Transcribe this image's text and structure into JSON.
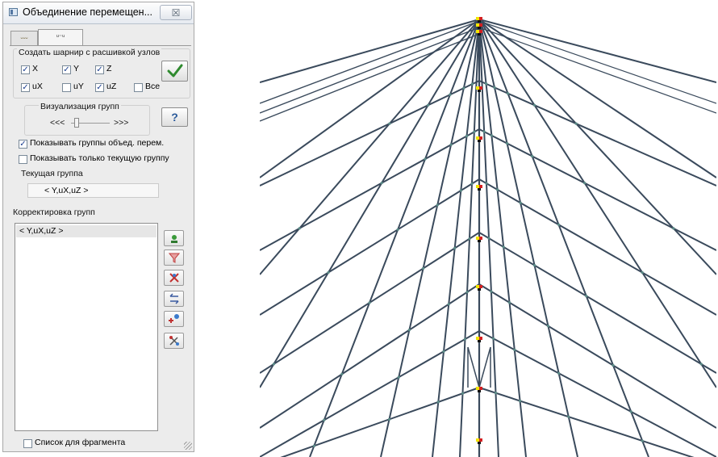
{
  "window": {
    "title": "Объединение перемещен...",
    "close_label": "☒"
  },
  "tabs": [
    {
      "label": "ᵕᵕᵕ",
      "icon": "rigid-link-icon"
    },
    {
      "label": "ᵘ⁻ᵘ",
      "icon": "joint-merge-icon"
    }
  ],
  "hinge": {
    "heading": "Создать шарнир с расшивкой узлов",
    "checks": [
      {
        "label": "X",
        "checked": true
      },
      {
        "label": "Y",
        "checked": true
      },
      {
        "label": "Z",
        "checked": true
      },
      {
        "label": "uX",
        "checked": true
      },
      {
        "label": "uY",
        "checked": false
      },
      {
        "label": "uZ",
        "checked": true
      },
      {
        "label": "Все",
        "checked": false
      }
    ],
    "apply_icon": "checkmark-icon"
  },
  "visualization": {
    "heading": "Визуализация групп",
    "prev_label": "<<<",
    "next_label": ">>>",
    "slider_value": 0,
    "help_label": "?"
  },
  "options": {
    "show_groups": {
      "label": "Показывать группы объед. перем.",
      "checked": true
    },
    "show_current_only": {
      "label": "Показывать только текущую группу",
      "checked": false
    }
  },
  "current_group": {
    "heading": "Текущая группа",
    "value": "< Y,uX,uZ >"
  },
  "groups": {
    "heading": "Корректировка групп",
    "items": [
      "< Y,uX,uZ >"
    ],
    "selected_index": 0
  },
  "side_buttons": [
    "add-group-icon",
    "filter-icon",
    "edit-group-icon",
    "swap-icon",
    "add-node-icon",
    "delete-group-icon"
  ],
  "fragment": {
    "label": "Список для фрагмента",
    "checked": false
  },
  "colors": {
    "mesh_lines": "#3a4a5c",
    "mesh_nodes": "#5a8a86",
    "joint_yellow": "#f2e600",
    "joint_red": "#d42020",
    "check_accent": "#2a4a9a"
  }
}
